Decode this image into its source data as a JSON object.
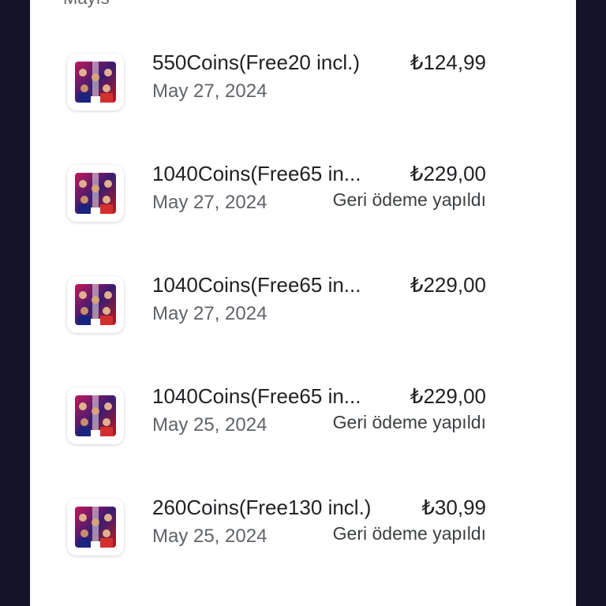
{
  "section": {
    "month_label": "Mayıs"
  },
  "purchases": [
    {
      "title": "550Coins(Free20 incl.)",
      "price": "₺124,99",
      "date": "May 27, 2024",
      "status": ""
    },
    {
      "title": "1040Coins(Free65 in...",
      "price": "₺229,00",
      "date": "May 27, 2024",
      "status": "Geri ödeme yapıldı"
    },
    {
      "title": "1040Coins(Free65 in...",
      "price": "₺229,00",
      "date": "May 27, 2024",
      "status": ""
    },
    {
      "title": "1040Coins(Free65 in...",
      "price": "₺229,00",
      "date": "May 25, 2024",
      "status": "Geri ödeme yapıldı"
    },
    {
      "title": "260Coins(Free130 incl.)",
      "price": "₺30,99",
      "date": "May 25, 2024",
      "status": "Geri ödeme yapıldı"
    }
  ],
  "icons": {
    "app_icon": "efootball-app-icon"
  },
  "colors": {
    "background": "#13142a",
    "panel": "#ffffff",
    "primary_text": "#202124",
    "secondary_text": "#5f6368"
  }
}
